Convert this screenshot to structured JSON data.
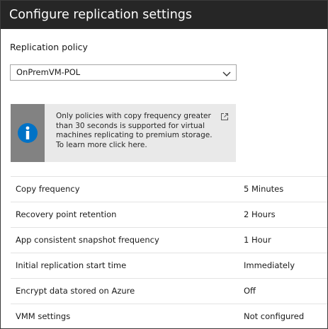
{
  "header": {
    "title": "Configure replication settings"
  },
  "policy": {
    "label": "Replication policy",
    "selected": "OnPremVM-POL",
    "chevron_icon": "chevron-down-icon"
  },
  "info": {
    "icon": "info-icon",
    "link_icon": "external-link-icon",
    "message": "Only policies with copy frequency greater than 30 seconds is supported for virtual machines replicating to premium storage. To learn more click here."
  },
  "settings": [
    {
      "label": "Copy frequency",
      "value": "5 Minutes"
    },
    {
      "label": "Recovery point retention",
      "value": "2 Hours"
    },
    {
      "label": "App consistent snapshot frequency",
      "value": "1 Hour"
    },
    {
      "label": "Initial replication start time",
      "value": "Immediately"
    },
    {
      "label": "Encrypt data stored on Azure",
      "value": "Off"
    },
    {
      "label": "VMM settings",
      "value": "Not configured"
    }
  ],
  "colors": {
    "header_bg": "#262626",
    "info_bg": "#e9e9e9",
    "info_icon_bg": "#828282",
    "info_icon_fill": "#0072c6"
  }
}
